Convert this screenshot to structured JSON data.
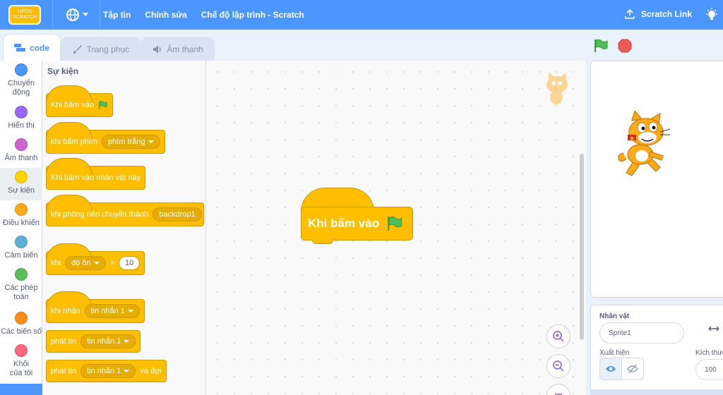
{
  "menubar": {
    "logo_line1": "OPEN",
    "logo_line2": "SCRATCH",
    "items": [
      "Tập tin",
      "Chỉnh sửa",
      "Chế độ lập trình - Scratch"
    ],
    "scratch_link": "Scratch Link",
    "icons": [
      "globe-icon",
      "upload-icon",
      "bulb-icon"
    ]
  },
  "tabs": [
    {
      "label": "code",
      "icon": "code-icon",
      "active": true
    },
    {
      "label": "Trang phục",
      "icon": "brush-icon",
      "active": false
    },
    {
      "label": "Âm thanh",
      "icon": "speaker-icon",
      "active": false
    }
  ],
  "categories": [
    {
      "label": "Chuyển động",
      "color": "#4c97ff"
    },
    {
      "label": "Hiển thị",
      "color": "#9966ff"
    },
    {
      "label": "Âm thanh",
      "color": "#cf63cf"
    },
    {
      "label": "Sự kiện",
      "color": "#ffd500",
      "selected": true
    },
    {
      "label": "Điều khiển",
      "color": "#ffab19"
    },
    {
      "label": "Cảm biến",
      "color": "#5cb1d6"
    },
    {
      "label": "Các phép toán",
      "color": "#59c059"
    },
    {
      "label": "Các biến số",
      "color": "#ff8c1a"
    },
    {
      "label": "Khối của tôi",
      "color": "#ff6680"
    }
  ],
  "flyout": {
    "title": "Sự kiện",
    "blocks": {
      "flag_clicked": "Khi bấm vào",
      "key_pressed": "khi bấm phím",
      "key_value": "phím trắng",
      "sprite_clicked": "Khi bấm vào nhân vật này",
      "backdrop_switch": "khi phông nền chuyển thành",
      "backdrop_value": "backdrop1",
      "when": "khi",
      "loudness": "độ ồn",
      "greater": ">",
      "threshold": "10",
      "receive": "khi nhận",
      "message": "tin nhắn 1",
      "broadcast": "phát tin",
      "broadcast_msg": "tin nhắn 1",
      "broadcast_wait": "phát tin",
      "broadcast_wait_msg": "tin nhắn 1",
      "and_wait": "và đợi"
    }
  },
  "workspace": {
    "block_label": "Khi bấm vào"
  },
  "sprite_info": {
    "sprite_label": "Nhân vật",
    "sprite_name": "Sprite1",
    "show_label": "Xuất hiện",
    "size_label": "Kích thướ",
    "size_value": "100"
  },
  "colors": {
    "menubar": "#4c97ff",
    "events": "#ffbf00",
    "flag": "#4cbf56",
    "stop": "#ec5959"
  }
}
